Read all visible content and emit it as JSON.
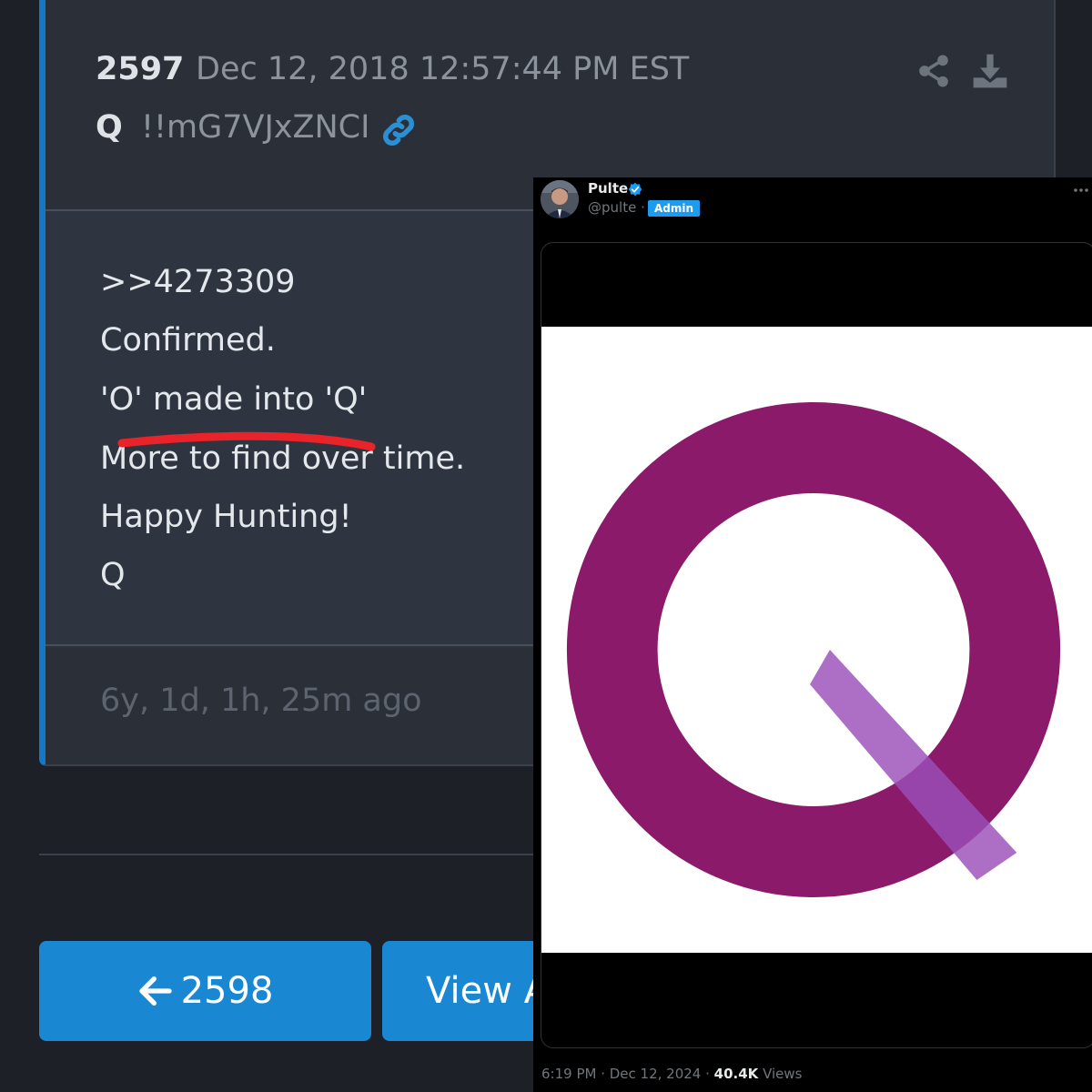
{
  "post": {
    "number": "2597",
    "date": "Dec 12, 2018 12:57:44 PM EST",
    "author": "Q",
    "tripcode": "!!mG7VJxZNCI",
    "lines": [
      ">>4273309",
      "Confirmed.",
      "'O' made into 'Q'",
      "More to find over time.",
      "Happy Hunting!",
      "Q"
    ],
    "age": "6y, 1d, 1h, 25m ago",
    "icons": {
      "link": "link-icon",
      "share": "share-icon",
      "download": "download-icon"
    },
    "accent_color": "#1478c7",
    "underline_color": "#e8242a"
  },
  "nav": {
    "prev_label": "2598",
    "prev_icon": "arrow-left-icon",
    "view_label": "View A"
  },
  "tweet": {
    "name": "Pulte",
    "handle": "@pulte",
    "separator": "·",
    "badge": "Admin",
    "time": "6:19 PM · Dec 12, 2024 ·",
    "views_count": "40.4K",
    "views_label": "Views",
    "verified_color": "#1d9bf0",
    "logo_colors": {
      "ring": "#8b1a6b",
      "tail": "#9a4fb8"
    }
  }
}
